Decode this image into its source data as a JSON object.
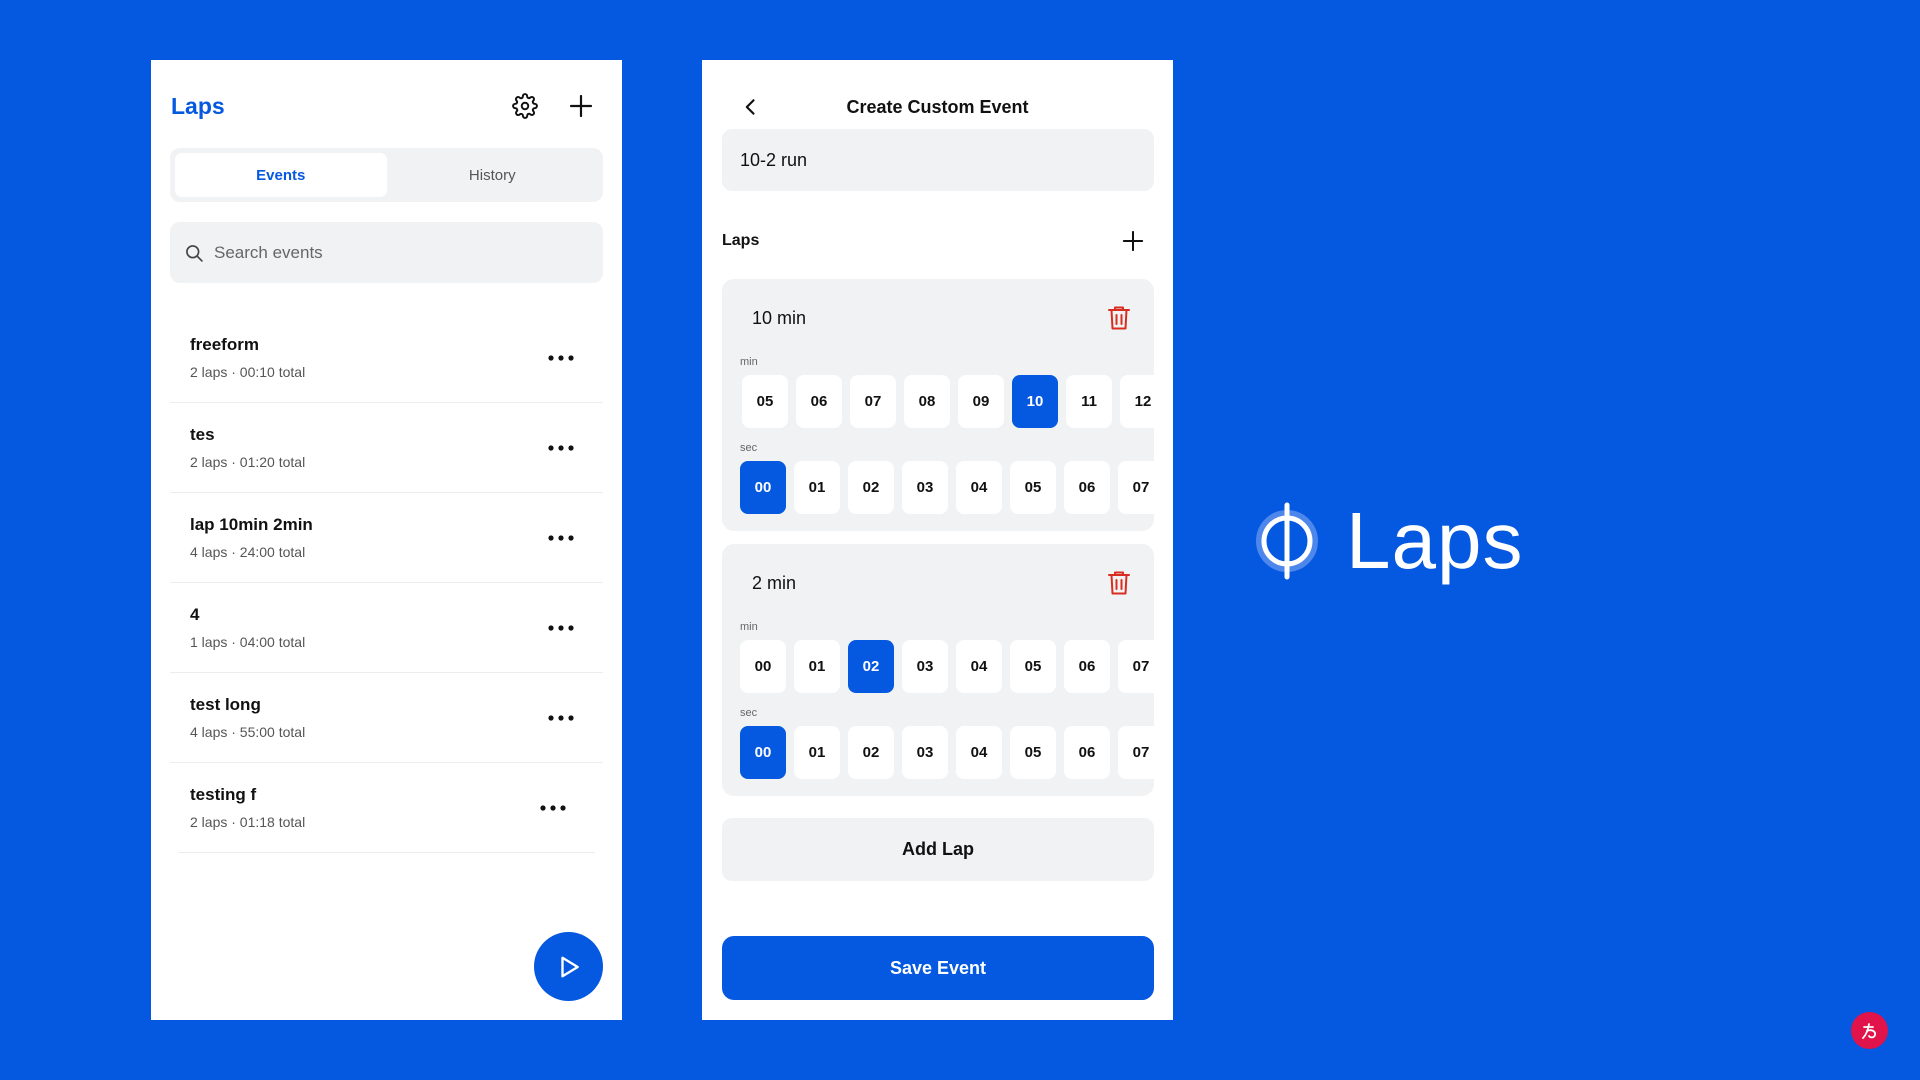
{
  "colors": {
    "background": "#0558E0",
    "accent": "#0558E0",
    "danger": "#D92D20",
    "surface": "#F1F2F4"
  },
  "events_screen": {
    "title": "Laps",
    "settings_icon": "gear-icon",
    "add_icon": "plus-icon",
    "tabs": [
      {
        "label": "Events",
        "active": true
      },
      {
        "label": "History",
        "active": false
      }
    ],
    "search": {
      "placeholder": "Search events",
      "value": ""
    },
    "events": [
      {
        "name": "freeform",
        "meta": "2 laps · 00:10 total"
      },
      {
        "name": "tes",
        "meta": "2 laps · 01:20 total"
      },
      {
        "name": "lap 10min 2min",
        "meta": "4 laps · 24:00 total"
      },
      {
        "name": "4",
        "meta": "1 laps · 04:00 total"
      },
      {
        "name": "test long",
        "meta": "4 laps · 55:00 total"
      },
      {
        "name": "testing f",
        "meta": "2 laps · 01:18 total"
      }
    ],
    "fab_icon": "play-icon"
  },
  "create_screen": {
    "title": "Create Custom Event",
    "event_name_value": "10-2 run",
    "laps_label": "Laps",
    "laps": [
      {
        "title": "10 min",
        "min_label": "min",
        "sec_label": "sec",
        "min_options": [
          "05",
          "06",
          "07",
          "08",
          "09",
          "10",
          "11",
          "12"
        ],
        "min_selected": "10",
        "sec_options": [
          "00",
          "01",
          "02",
          "03",
          "04",
          "05",
          "06",
          "07"
        ],
        "sec_selected": "00"
      },
      {
        "title": "2 min",
        "min_label": "min",
        "sec_label": "sec",
        "min_options": [
          "00",
          "01",
          "02",
          "03",
          "04",
          "05",
          "06",
          "07"
        ],
        "min_selected": "02",
        "sec_options": [
          "00",
          "01",
          "02",
          "03",
          "04",
          "05",
          "06",
          "07"
        ],
        "sec_selected": "00"
      }
    ],
    "add_lap_label": "Add Lap",
    "save_label": "Save Event"
  },
  "brand": {
    "name": "Laps"
  }
}
